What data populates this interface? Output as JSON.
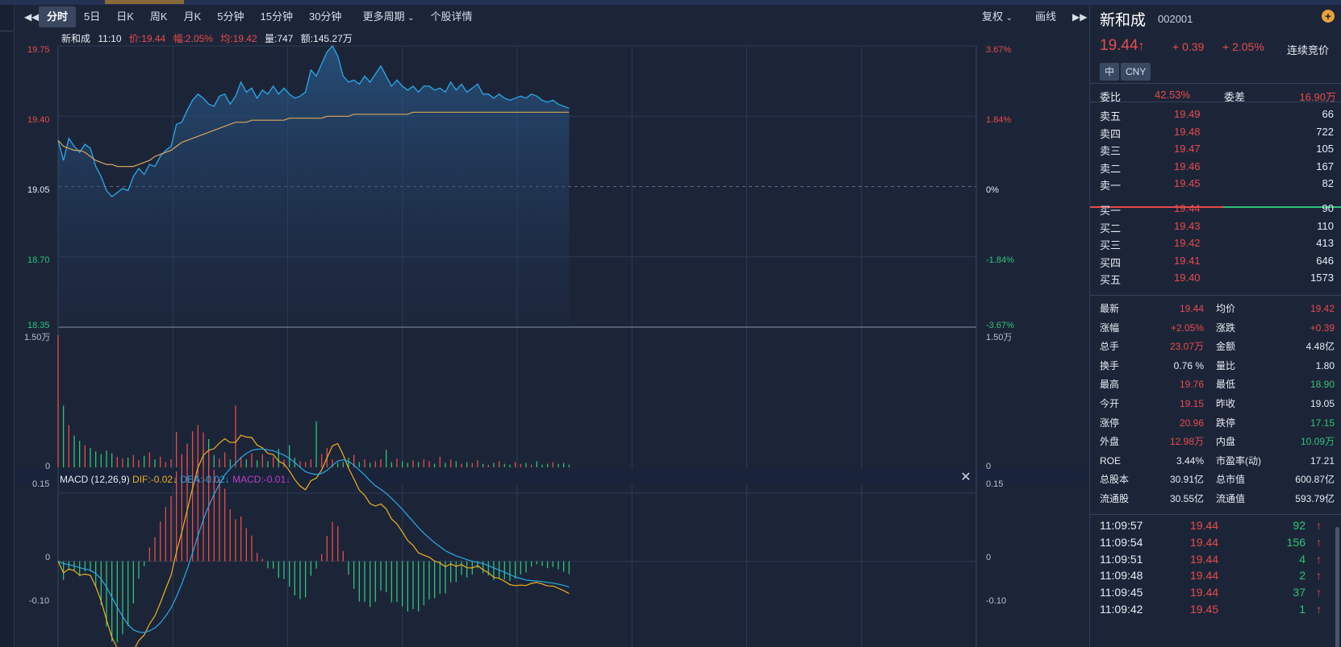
{
  "toolbar": {
    "prev_icon": "double-left-triangle",
    "tabs": [
      "分时",
      "5日",
      "日K",
      "周K",
      "月K",
      "5分钟",
      "15分钟",
      "30分钟"
    ],
    "more_period": "更多周期",
    "detail": "个股详情",
    "fuquan": "复权",
    "draw": "画线",
    "next_icon": "double-right-triangle"
  },
  "info": {
    "name": "新和成",
    "time": "11:10",
    "price": "价:19.44",
    "change": "幅:2.05%",
    "avg": "均:19.42",
    "volume": "量:747",
    "amount": "额:145.27万"
  },
  "axes": {
    "price_left": [
      "19.75",
      "19.40",
      "19.05",
      "18.70",
      "18.35"
    ],
    "price_right": [
      "3.67%",
      "1.84%",
      "0%",
      "-1.84%",
      "-3.67%"
    ],
    "vol_left": [
      "1.50万",
      "0"
    ],
    "vol_right": [
      "1.50万",
      "0"
    ],
    "macd_left": [
      "0.15",
      "0",
      "-0.10"
    ],
    "macd_right": [
      "0.15",
      "0",
      "-0.10"
    ]
  },
  "macd": {
    "label": "MACD (12,26,9)",
    "dif": "DIF:-0.02",
    "dea": "DEA:-0.02",
    "macd": "MACD:-0.01",
    "down_arrow": "↓"
  },
  "chart_data": {
    "type": "line",
    "series": [
      {
        "values": [
          19.28,
          19.18,
          19.29,
          19.25,
          19.22,
          19.26,
          19.24,
          19.15,
          19.1,
          19.03,
          19.0,
          19.02,
          19.04,
          19.03,
          19.1,
          19.14,
          19.11,
          19.16,
          19.15,
          19.2,
          19.23,
          19.25,
          19.36,
          19.37,
          19.43,
          19.48,
          19.51,
          19.49,
          19.46,
          19.45,
          19.5,
          19.51,
          19.46,
          19.5,
          19.57,
          19.52,
          19.54,
          19.49,
          19.53,
          19.51,
          19.55,
          19.51,
          19.54,
          19.51,
          19.49,
          19.5,
          19.52,
          19.63,
          19.6,
          19.66,
          19.72,
          19.75,
          19.7,
          19.6,
          19.57,
          19.58,
          19.56,
          19.6,
          19.57,
          19.61,
          19.65,
          19.6,
          19.55,
          19.58,
          19.55,
          19.53,
          19.55,
          19.52,
          19.55,
          19.55,
          19.53,
          19.54,
          19.52,
          19.57,
          19.53,
          19.56,
          19.52,
          19.54,
          19.56,
          19.51,
          19.51,
          19.49,
          19.51,
          19.49,
          19.48,
          19.49,
          19.5,
          19.49,
          19.51,
          19.5,
          19.48,
          19.47,
          19.48,
          19.46,
          19.45,
          19.44
        ]
      },
      {
        "values": [
          19.28,
          19.25,
          19.24,
          19.23,
          19.23,
          19.22,
          19.2,
          19.18,
          19.17,
          19.16,
          19.16,
          19.15,
          19.15,
          19.15,
          19.15,
          19.16,
          19.17,
          19.18,
          19.2,
          19.21,
          19.22,
          19.23,
          19.25,
          19.27,
          19.28,
          19.29,
          19.3,
          19.31,
          19.32,
          19.33,
          19.34,
          19.35,
          19.36,
          19.37,
          19.37,
          19.37,
          19.38,
          19.38,
          19.38,
          19.38,
          19.38,
          19.38,
          19.38,
          19.39,
          19.39,
          19.39,
          19.39,
          19.39,
          19.39,
          19.39,
          19.4,
          19.4,
          19.4,
          19.4,
          19.4,
          19.41,
          19.41,
          19.41,
          19.41,
          19.41,
          19.41,
          19.41,
          19.41,
          19.41,
          19.41,
          19.41,
          19.42,
          19.42,
          19.42,
          19.42,
          19.42,
          19.42,
          19.42,
          19.42,
          19.42,
          19.42,
          19.42,
          19.42,
          19.42,
          19.42,
          19.42,
          19.42,
          19.42,
          19.42,
          19.42,
          19.42,
          19.42,
          19.42,
          19.42,
          19.42,
          19.42,
          19.42,
          19.42,
          19.42,
          19.42,
          19.42
        ]
      }
    ],
    "ylim": [
      18.35,
      19.75
    ],
    "volume": [
      15000,
      7000,
      4800,
      3600,
      3000,
      2500,
      2200,
      1800,
      1500,
      1900,
      1600,
      1200,
      1000,
      1100,
      1400,
      800,
      1300,
      1700,
      900,
      1200,
      600,
      900,
      4000,
      1500,
      1300,
      700,
      1100,
      2000,
      3200,
      1400,
      1000,
      1700,
      900,
      7000,
      1200,
      900,
      1600,
      800,
      1500,
      700,
      1200,
      2100,
      900,
      2500,
      1100,
      700,
      600,
      900,
      5200,
      1500,
      2200,
      900,
      500,
      600,
      1100,
      1400,
      600,
      900,
      500,
      700,
      900,
      2000,
      600,
      1000,
      700,
      500,
      800,
      600,
      900,
      700,
      400,
      1200,
      500,
      900,
      700,
      400,
      600,
      500,
      800,
      400,
      300,
      500,
      700,
      400,
      300,
      600,
      400,
      500,
      300,
      700,
      300,
      400,
      600,
      400,
      500,
      300
    ],
    "vol_ylim": [
      0,
      15000
    ],
    "macd_ylim": [
      -0.1,
      0.15
    ]
  },
  "sidebar": {
    "name": "新和成",
    "code": "002001",
    "add_icon": "plus-circle-icon",
    "price": "19.44",
    "up_arrow": "↑",
    "change": "+ 0.39",
    "pct": "+ 2.05%",
    "status": "连续竞价",
    "badges": [
      "中",
      "CNY"
    ],
    "webi_label": "委比",
    "webi_value": "42.53%",
    "weicha_label": "委差",
    "weicha_value": "16.90万",
    "asks": [
      {
        "label": "卖五",
        "price": "19.49",
        "vol": "66"
      },
      {
        "label": "卖四",
        "price": "19.48",
        "vol": "722"
      },
      {
        "label": "卖三",
        "price": "19.47",
        "vol": "105"
      },
      {
        "label": "卖二",
        "price": "19.46",
        "vol": "167"
      },
      {
        "label": "卖一",
        "price": "19.45",
        "vol": "82"
      }
    ],
    "bids": [
      {
        "label": "买一",
        "price": "19.44",
        "vol": "90"
      },
      {
        "label": "买二",
        "price": "19.43",
        "vol": "110"
      },
      {
        "label": "买三",
        "price": "19.42",
        "vol": "413"
      },
      {
        "label": "买四",
        "price": "19.41",
        "vol": "646"
      },
      {
        "label": "买五",
        "price": "19.40",
        "vol": "1573"
      }
    ],
    "stats": [
      {
        "l1": "最新",
        "v1": "19.44",
        "c1": "red",
        "l2": "均价",
        "v2": "19.42",
        "c2": "red"
      },
      {
        "l1": "涨幅",
        "v1": "+2.05%",
        "c1": "red",
        "l2": "涨跌",
        "v2": "+0.39",
        "c2": "red"
      },
      {
        "l1": "总手",
        "v1": "23.07万",
        "c1": "red",
        "l2": "金额",
        "v2": "4.48亿",
        "c2": "white"
      },
      {
        "l1": "换手",
        "v1": "0.76 %",
        "c1": "white",
        "l2": "量比",
        "v2": "1.80",
        "c2": "white"
      },
      {
        "l1": "最高",
        "v1": "19.76",
        "c1": "red",
        "l2": "最低",
        "v2": "18.90",
        "c2": "green"
      },
      {
        "l1": "今开",
        "v1": "19.15",
        "c1": "red",
        "l2": "昨收",
        "v2": "19.05",
        "c2": "white"
      },
      {
        "l1": "涨停",
        "v1": "20.96",
        "c1": "red",
        "l2": "跌停",
        "v2": "17.15",
        "c2": "green"
      },
      {
        "l1": "外盘",
        "v1": "12.98万",
        "c1": "red",
        "l2": "内盘",
        "v2": "10.09万",
        "c2": "green"
      },
      {
        "l1": "ROE",
        "v1": "3.44%",
        "c1": "white",
        "l2": "市盈率(动)",
        "v2": "17.21",
        "c2": "white"
      },
      {
        "l1": "总股本",
        "v1": "30.91亿",
        "c1": "white",
        "l2": "总市值",
        "v2": "600.87亿",
        "c2": "white"
      },
      {
        "l1": "流通股",
        "v1": "30.55亿",
        "c1": "white",
        "l2": "流通值",
        "v2": "593.79亿",
        "c2": "white"
      }
    ],
    "ticks": [
      {
        "time": "11:09:57",
        "price": "19.44",
        "vol": "92",
        "arrow": "↑"
      },
      {
        "time": "11:09:54",
        "price": "19.44",
        "vol": "156",
        "arrow": "↑"
      },
      {
        "time": "11:09:51",
        "price": "19.44",
        "vol": "4",
        "arrow": "↑"
      },
      {
        "time": "11:09:48",
        "price": "19.44",
        "vol": "2",
        "arrow": "↑"
      },
      {
        "time": "11:09:45",
        "price": "19.44",
        "vol": "37",
        "arrow": "↑"
      },
      {
        "time": "11:09:42",
        "price": "19.45",
        "vol": "1",
        "arrow": "↑"
      }
    ]
  },
  "colors": {
    "red": "#e84b4b",
    "green": "#2fc27b",
    "price_line": "#2aa9e8",
    "avg_line": "#d9a55a"
  }
}
